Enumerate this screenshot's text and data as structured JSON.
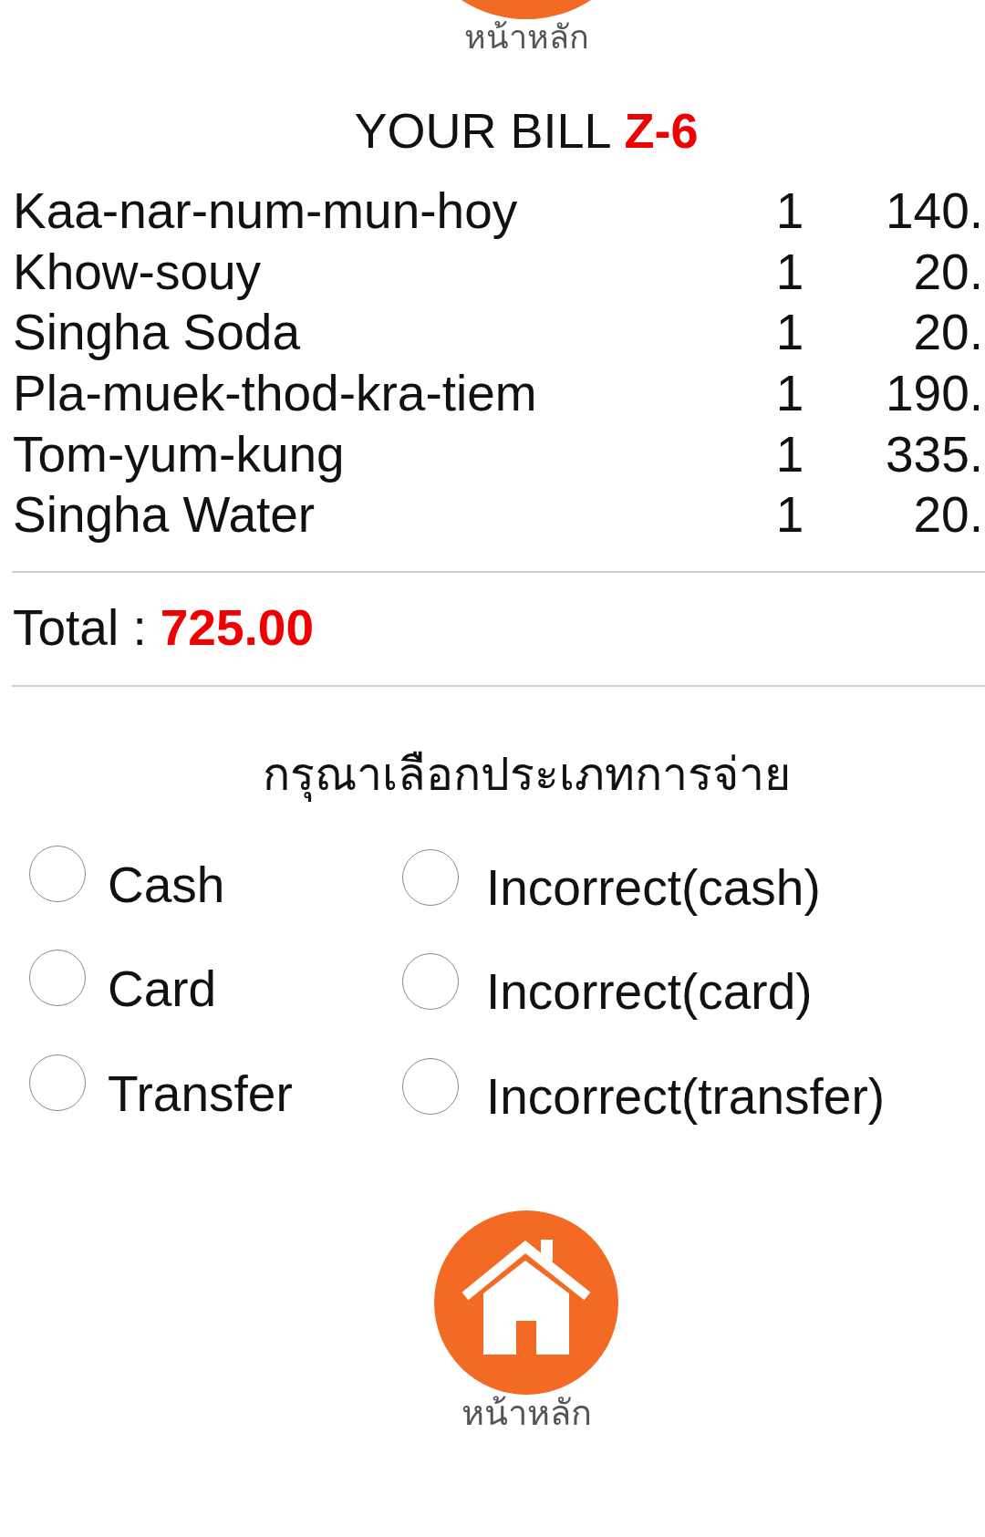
{
  "top_nav": {
    "label": "หน้าหลัก"
  },
  "bill": {
    "title": "YOUR BILL",
    "number": "Z-6"
  },
  "items": [
    {
      "name": "Kaa-nar-num-mun-hoy",
      "qty": "1",
      "price": "140."
    },
    {
      "name": "Khow-souy",
      "qty": "1",
      "price": "20."
    },
    {
      "name": "Singha Soda",
      "qty": "1",
      "price": "20."
    },
    {
      "name": "Pla-muek-thod-kra-tiem",
      "qty": "1",
      "price": "190."
    },
    {
      "name": "Tom-yum-kung",
      "qty": "1",
      "price": "335."
    },
    {
      "name": "Singha Water",
      "qty": "1",
      "price": "20."
    }
  ],
  "total": {
    "label": "Total :",
    "amount": "725.00"
  },
  "payment": {
    "heading": "กรุณาเลือกประเภทการจ่าย",
    "columns": [
      {
        "options": [
          {
            "label": "Cash",
            "selected": false
          },
          {
            "label": "Card",
            "selected": false
          },
          {
            "label": "Transfer",
            "selected": false
          }
        ]
      },
      {
        "options": [
          {
            "label": "Incorrect(cash)",
            "selected": false
          },
          {
            "label": "Incorrect(card)",
            "selected": false
          },
          {
            "label": "Incorrect(transfer)",
            "selected": false
          }
        ]
      }
    ]
  },
  "bottom_nav": {
    "label": "หน้าหลัก"
  }
}
